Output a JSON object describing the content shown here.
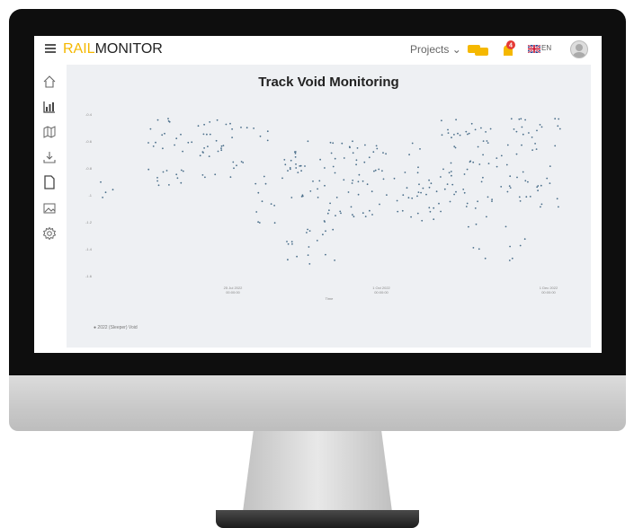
{
  "app": {
    "logo_rail": "RAIL",
    "logo_monitor": "MONITOR",
    "projects_label": "Projects",
    "projects_caret": "⌄",
    "notification_count": "4",
    "language": "EN"
  },
  "sidebar": {
    "items": [
      "home-icon",
      "chart-icon",
      "map-icon",
      "download-icon",
      "document-icon",
      "image-icon",
      "settings-icon"
    ]
  },
  "colors": {
    "brand": "#f5b800",
    "notification": "#e53935",
    "points": "#4a6e8a"
  },
  "chart_data": {
    "type": "scatter",
    "title": "Track Void Monitoring",
    "xlabel": "Time",
    "ylabel": "",
    "y_ticks": [
      "-0.4",
      "-0.6",
      "-0.8",
      "-1",
      "-1.2",
      "-1.4",
      "-1.6"
    ],
    "x_ticks": [
      "25 Jul 2022\n00:00:00",
      "1 Oct 2022\n00:00:00",
      "1 Dec 2022\n00:00:00"
    ],
    "legend": "2022 (Sleeper) Void",
    "grid": false
  }
}
